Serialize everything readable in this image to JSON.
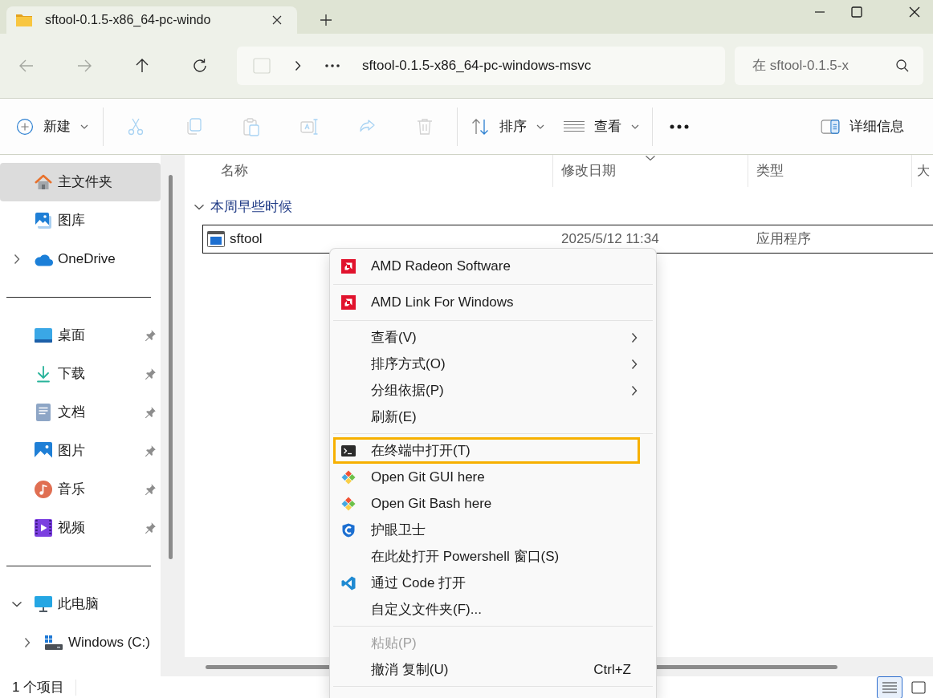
{
  "window": {
    "tab_title": "sftool-0.1.5-x86_64-pc-windo"
  },
  "navigation": [
    {
      "kind": "back",
      "disabled": true
    },
    {
      "kind": "forward",
      "disabled": true
    },
    {
      "kind": "up",
      "disabled": false
    },
    {
      "kind": "refresh",
      "disabled": false
    }
  ],
  "address_bar": {
    "path": "sftool-0.1.5-x86_64-pc-windows-msvc"
  },
  "search": {
    "placeholder": "在 sftool-0.1.5-x"
  },
  "toolbar": {
    "groups": [
      [
        {
          "kind": "new",
          "label": "新建",
          "dropdown": true,
          "disabled": false
        }
      ],
      [
        {
          "kind": "cut",
          "dropdown": false,
          "disabled": true
        },
        {
          "kind": "copy",
          "dropdown": false,
          "disabled": true
        },
        {
          "kind": "paste",
          "dropdown": false,
          "disabled": true
        },
        {
          "kind": "rename",
          "dropdown": false,
          "disabled": true
        },
        {
          "kind": "share",
          "dropdown": false,
          "disabled": true
        },
        {
          "kind": "delete",
          "dropdown": false,
          "disabled": true
        }
      ],
      [
        {
          "kind": "sort",
          "label": "排序",
          "dropdown": true,
          "disabled": false
        },
        {
          "kind": "view",
          "label": "查看",
          "dropdown": true,
          "disabled": false
        }
      ],
      [
        {
          "kind": "more",
          "dropdown": false,
          "disabled": false
        }
      ]
    ],
    "details_pane": {
      "label": "详细信息"
    }
  },
  "sidebar": {
    "groups": [
      {
        "items": [
          {
            "kind": "home",
            "label": "主文件夹",
            "selected": true
          },
          {
            "kind": "gallery",
            "label": "图库",
            "selected": false
          },
          {
            "kind": "cloud",
            "label": "OneDrive",
            "selected": false,
            "expanded": false
          }
        ]
      },
      {
        "items": [
          {
            "kind": "desktop",
            "label": "桌面",
            "selected": false,
            "pinned": true
          },
          {
            "kind": "downloads",
            "label": "下载",
            "selected": false,
            "pinned": true
          },
          {
            "kind": "documents",
            "label": "文档",
            "selected": false,
            "pinned": true
          },
          {
            "kind": "pictures",
            "label": "图片",
            "selected": false,
            "pinned": true
          },
          {
            "kind": "music",
            "label": "音乐",
            "selected": false,
            "pinned": true
          },
          {
            "kind": "videos",
            "label": "视频",
            "selected": false,
            "pinned": true
          }
        ]
      },
      {
        "items": [
          {
            "kind": "computer",
            "label": "此电脑",
            "selected": false,
            "expanded": true,
            "children": [
              {
                "kind": "drive",
                "label": "Windows (C:)",
                "selected": false,
                "expanded": false
              }
            ]
          }
        ]
      }
    ]
  },
  "file_list": {
    "columns": [
      {
        "label": "名称",
        "sorted": false
      },
      {
        "label": "修改日期",
        "sorted": true
      },
      {
        "label": "类型",
        "sorted": false
      },
      {
        "label": "大",
        "sorted": false
      }
    ],
    "groups": [
      {
        "label": "本周早些时候",
        "expanded": true,
        "rows": [
          {
            "name": "sftool",
            "modified": "2025/5/12 11:34",
            "type": "应用程序",
            "focused": true
          }
        ]
      }
    ]
  },
  "status_bar": {
    "text": "1 个项目",
    "views": [
      {
        "kind": "details",
        "selected": true
      },
      {
        "kind": "tiles",
        "selected": false
      }
    ]
  },
  "context_menu": {
    "continues_below": true,
    "sections": [
      [
        {
          "kind": "amd",
          "label": "AMD Radeon Software",
          "submenu": false,
          "disabled": false,
          "highlighted": false
        }
      ],
      [
        {
          "kind": "amd",
          "label": "AMD Link For Windows",
          "submenu": false,
          "disabled": false,
          "highlighted": false
        }
      ],
      [
        {
          "kind": "plain",
          "label": "查看(V)",
          "submenu": true,
          "disabled": false,
          "highlighted": false
        },
        {
          "kind": "plain",
          "label": "排序方式(O)",
          "submenu": true,
          "disabled": false,
          "highlighted": false
        },
        {
          "kind": "plain",
          "label": "分组依据(P)",
          "submenu": true,
          "disabled": false,
          "highlighted": false
        },
        {
          "kind": "plain",
          "label": "刷新(E)",
          "submenu": false,
          "disabled": false,
          "highlighted": false
        }
      ],
      [
        {
          "kind": "terminal",
          "label": "在终端中打开(T)",
          "submenu": false,
          "disabled": false,
          "highlighted": true
        },
        {
          "kind": "git",
          "label": "Open Git GUI here",
          "submenu": false,
          "disabled": false,
          "highlighted": false
        },
        {
          "kind": "git",
          "label": "Open Git Bash here",
          "submenu": false,
          "disabled": false,
          "highlighted": false
        },
        {
          "kind": "shield",
          "label": "护眼卫士",
          "submenu": false,
          "disabled": false,
          "highlighted": false
        },
        {
          "kind": "plain",
          "label": "在此处打开 Powershell 窗口(S)",
          "submenu": false,
          "disabled": false,
          "highlighted": false
        },
        {
          "kind": "code",
          "label": "通过 Code 打开",
          "submenu": false,
          "disabled": false,
          "highlighted": false
        },
        {
          "kind": "plain",
          "label": "自定义文件夹(F)...",
          "submenu": false,
          "disabled": false,
          "highlighted": false
        }
      ],
      [
        {
          "kind": "plain",
          "label": "粘贴(P)",
          "submenu": false,
          "disabled": true,
          "highlighted": false
        },
        {
          "kind": "plain",
          "label": "撤消 复制(U)",
          "shortcut": "Ctrl+Z",
          "submenu": false,
          "disabled": false,
          "highlighted": false
        }
      ]
    ]
  }
}
